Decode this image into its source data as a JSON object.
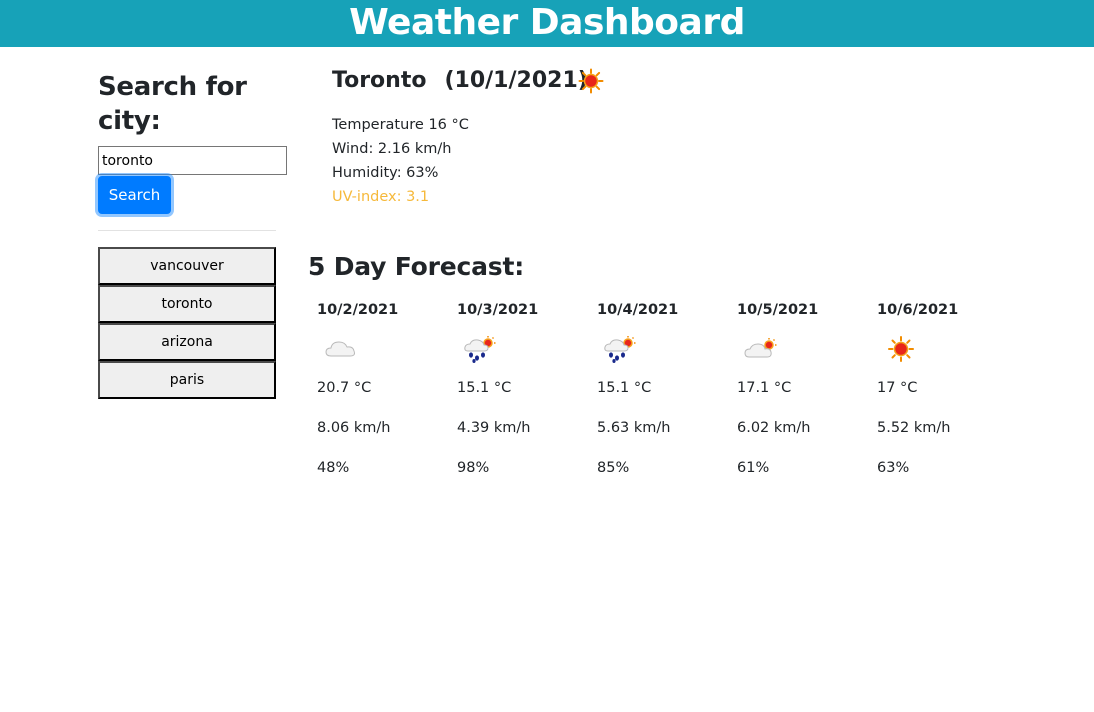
{
  "header": {
    "title": "Weather Dashboard"
  },
  "sidebar": {
    "title": "Search for city:",
    "search_value": "toronto",
    "search_button": "Search",
    "history": [
      "vancouver",
      "toronto",
      "arizona",
      "paris"
    ]
  },
  "current": {
    "city": "Toronto",
    "date": "(10/1/2021)",
    "icon": "sun-icon",
    "temperature": "Temperature 16 °C",
    "wind": "Wind: 2.16 km/h",
    "humidity": "Humidity: 63%",
    "uv": "UV-index: 3.1",
    "uv_color": "#f6b93b"
  },
  "forecast": {
    "title": "5 Day Forecast:",
    "days": [
      {
        "date": "10/2/2021",
        "icon": "cloud-icon",
        "temp": "20.7 °C",
        "wind": "8.06 km/h",
        "humidity": "48%"
      },
      {
        "date": "10/3/2021",
        "icon": "rain-sun-icon",
        "temp": "15.1 °C",
        "wind": "4.39 km/h",
        "humidity": "98%"
      },
      {
        "date": "10/4/2021",
        "icon": "rain-sun-icon",
        "temp": "15.1 °C",
        "wind": "5.63 km/h",
        "humidity": "85%"
      },
      {
        "date": "10/5/2021",
        "icon": "cloud-sun-icon",
        "temp": "17.1 °C",
        "wind": "6.02 km/h",
        "humidity": "61%"
      },
      {
        "date": "10/6/2021",
        "icon": "sun-icon",
        "temp": "17 °C",
        "wind": "5.52 km/h",
        "humidity": "63%"
      }
    ]
  },
  "colors": {
    "header_bg": "#17a2b8",
    "button_primary": "#007bff",
    "uv_moderate": "#f6b93b"
  }
}
